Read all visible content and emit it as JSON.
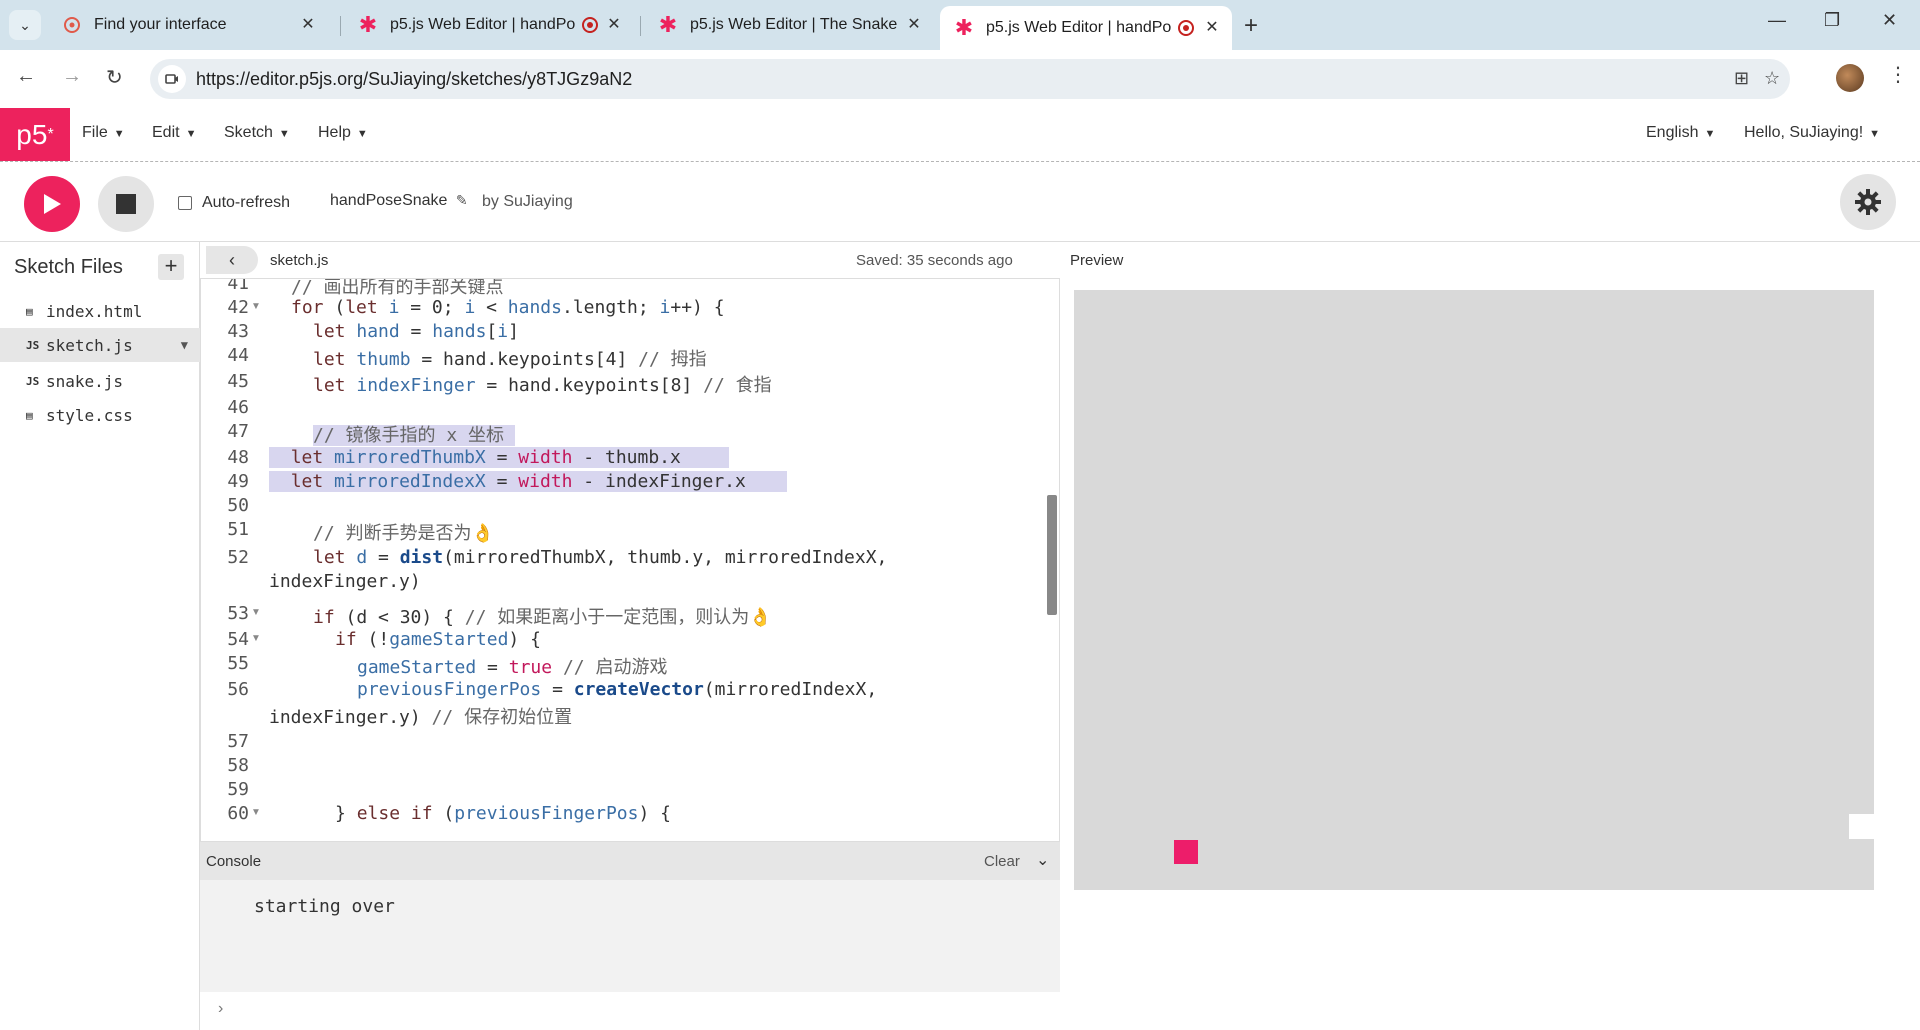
{
  "browser": {
    "tabs": [
      {
        "title": "Find your interface",
        "icon": "figma-icon"
      },
      {
        "title": "p5.js Web Editor | handPo",
        "icon": "p5-asterisk-icon"
      },
      {
        "title": "p5.js Web Editor | The Snake",
        "icon": "p5-asterisk-icon"
      },
      {
        "title": "p5.js Web Editor | handPo",
        "icon": "p5-asterisk-icon"
      }
    ],
    "url": "https://editor.p5js.org/SuJiaying/sketches/y8TJGz9aN2"
  },
  "nav": {
    "logo": "p5",
    "logo_sup": "*",
    "menus": [
      "File",
      "Edit",
      "Sketch",
      "Help"
    ],
    "language": "English",
    "user": "Hello, SuJiaying!"
  },
  "toolbar": {
    "autorefresh_label": "Auto-refresh",
    "project_name": "handPoseSnake",
    "byline": "by SuJiaying"
  },
  "sidebar": {
    "title": "Sketch Files",
    "files": [
      {
        "name": "index.html",
        "type": "html"
      },
      {
        "name": "sketch.js",
        "type": "js"
      },
      {
        "name": "snake.js",
        "type": "js"
      },
      {
        "name": "style.css",
        "type": "css"
      }
    ]
  },
  "editor": {
    "filename": "sketch.js",
    "saved": "Saved: 35 seconds ago",
    "line_numbers": [
      "41",
      "42",
      "43",
      "44",
      "45",
      "46",
      "47",
      "48",
      "49",
      "50",
      "51",
      "52",
      "53",
      "54",
      "55",
      "56",
      "57",
      "58",
      "59",
      "60"
    ]
  },
  "console": {
    "title": "Console",
    "clear": "Clear",
    "message": "starting over"
  },
  "preview": {
    "title": "Preview"
  },
  "colors": {
    "p5_pink": "#ed225d",
    "food": "#ed1d6a",
    "canvas_bg": "#d9d9d9",
    "selection": "#d8d6ef"
  }
}
